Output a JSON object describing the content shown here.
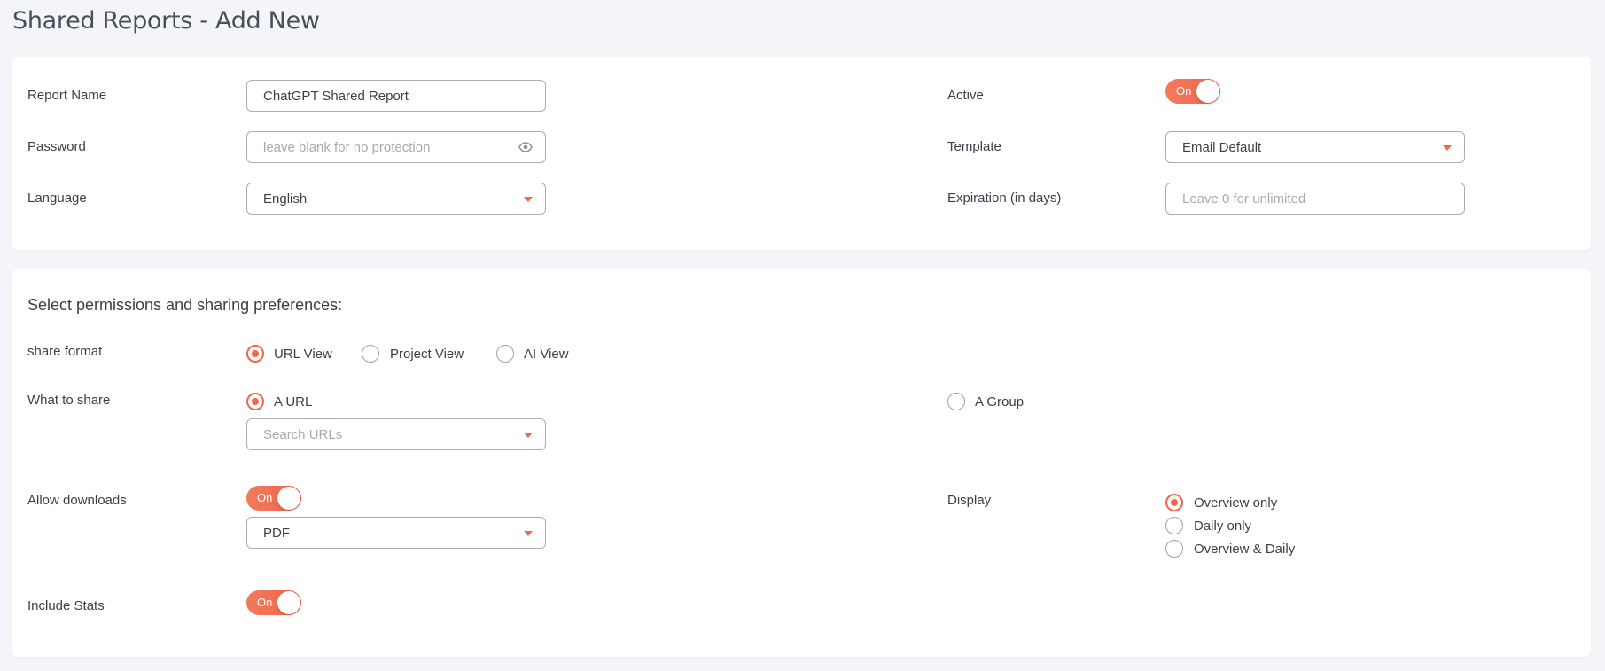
{
  "page_title": "Shared Reports - Add New",
  "colors": {
    "accent": "#f0664e",
    "background": "#f3f5f9",
    "card": "#ffffff",
    "border": "#a9adb5"
  },
  "general": {
    "report_name_label": "Report Name",
    "report_name_value": "ChatGPT Shared Report",
    "password_label": "Password",
    "password_placeholder": "leave blank for no protection",
    "password_icon": "eye-icon",
    "language_label": "Language",
    "language_value": "English",
    "active_label": "Active",
    "active_toggle": "On",
    "template_label": "Template",
    "template_value": "Email Default",
    "expiration_label": "Expiration (in days)",
    "expiration_placeholder": "Leave 0 for unlimited"
  },
  "permissions": {
    "heading": "Select permissions and sharing preferences:",
    "share_format_label": "share format",
    "share_format_options": [
      {
        "label": "URL View",
        "selected": true
      },
      {
        "label": "Project View",
        "selected": false
      },
      {
        "label": "AI View",
        "selected": false
      }
    ],
    "what_to_share_label": "What to share",
    "what_to_share_options": [
      {
        "label": "A URL",
        "selected": true
      },
      {
        "label": "A Group",
        "selected": false
      }
    ],
    "search_urls_placeholder": "Search URLs",
    "allow_downloads_label": "Allow downloads",
    "allow_downloads_toggle": "On",
    "download_format_value": "PDF",
    "display_label": "Display",
    "display_options": [
      {
        "label": "Overview only",
        "selected": true
      },
      {
        "label": "Daily only",
        "selected": false
      },
      {
        "label": "Overview & Daily",
        "selected": false
      }
    ],
    "include_stats_label": "Include Stats",
    "include_stats_toggle": "On"
  }
}
